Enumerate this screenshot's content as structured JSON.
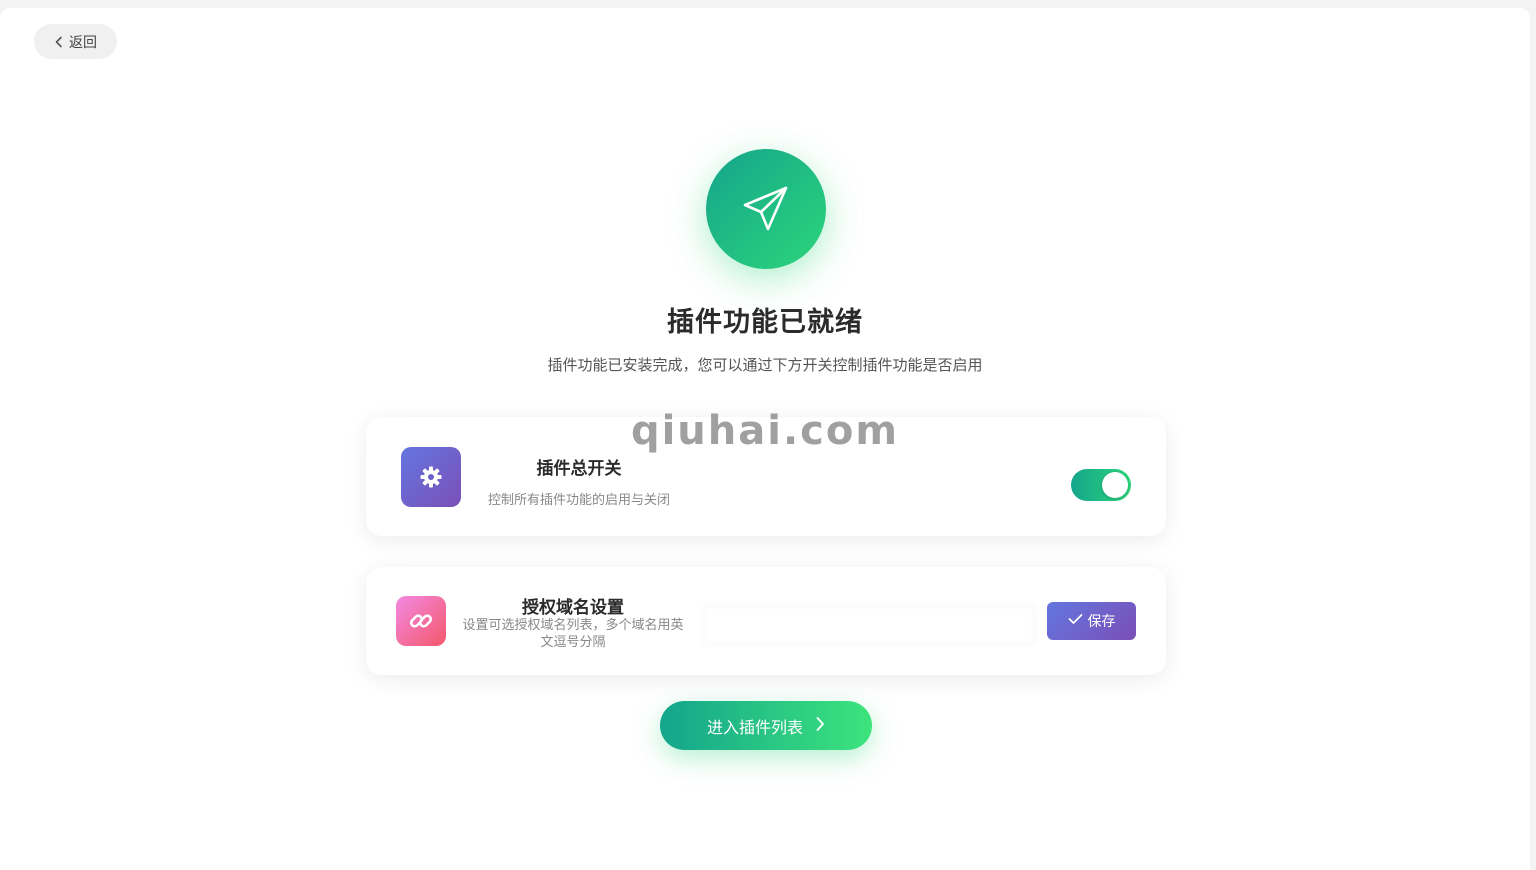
{
  "nav": {
    "back_label": "返回"
  },
  "hero": {
    "icon": "paper-plane-icon",
    "title": "插件功能已就绪",
    "subtitle": "插件功能已安装完成，您可以通过下方开关控制插件功能是否启用"
  },
  "switch_card": {
    "icon": "gear-icon",
    "title": "插件总开关",
    "description": "控制所有插件功能的启用与关闭",
    "enabled": true
  },
  "domain_card": {
    "icon": "link-icon",
    "title": "授权域名设置",
    "description": "设置可选授权域名列表，多个域名用英文逗号分隔",
    "save_label": "保存",
    "save_icon": "check-icon"
  },
  "enter_button": {
    "label": "进入插件列表",
    "icon": "chevron-right-icon"
  },
  "watermark": "qiuhai.com",
  "colors": {
    "accent_green_start": "#14a58c",
    "accent_green_end": "#2cd57a",
    "purple_start": "#6476e0",
    "purple_end": "#7a4fb6",
    "pink_start": "#f28ae0",
    "pink_end": "#f5576c"
  }
}
